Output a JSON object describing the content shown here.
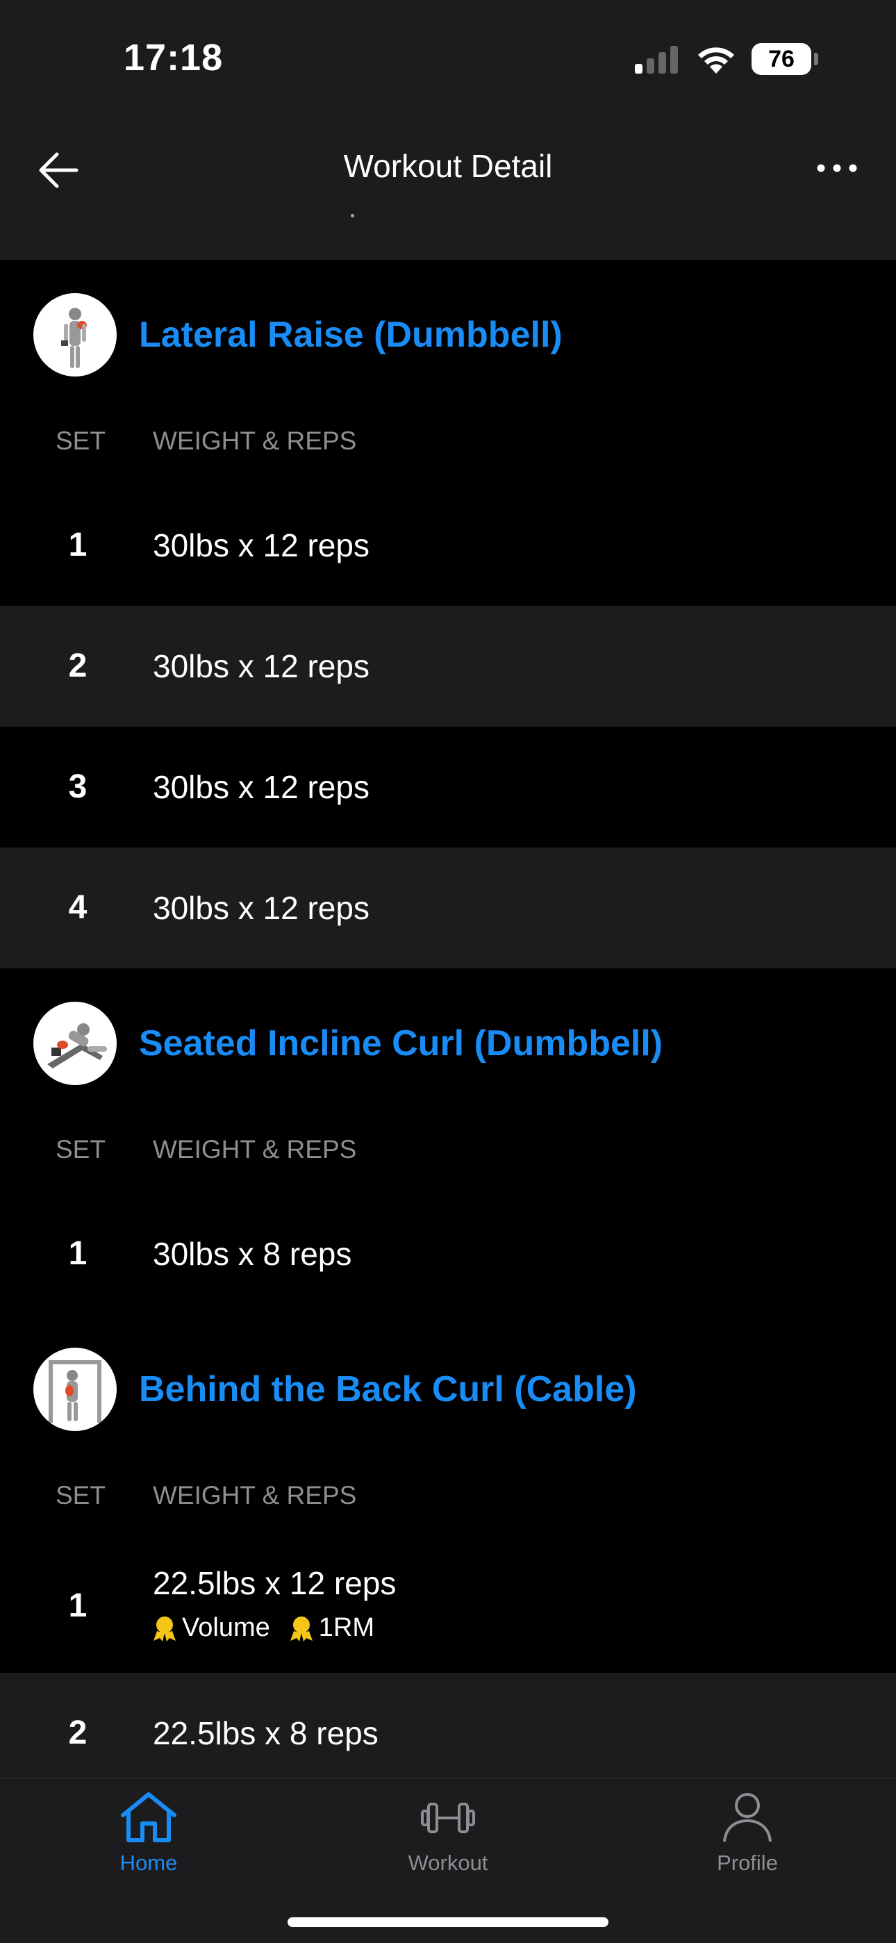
{
  "status_bar": {
    "time": "17:18",
    "battery": "76"
  },
  "header": {
    "title": "Workout Detail"
  },
  "columns": {
    "set": "SET",
    "weight_reps": "WEIGHT & REPS"
  },
  "exercises": [
    {
      "name": "Lateral Raise (Dumbbell)",
      "sets": [
        {
          "num": "1",
          "value": "30lbs x 12 reps"
        },
        {
          "num": "2",
          "value": "30lbs x 12 reps"
        },
        {
          "num": "3",
          "value": "30lbs x 12 reps"
        },
        {
          "num": "4",
          "value": "30lbs x 12 reps"
        }
      ]
    },
    {
      "name": "Seated Incline Curl (Dumbbell)",
      "sets": [
        {
          "num": "1",
          "value": "30lbs x 8 reps"
        }
      ]
    },
    {
      "name": "Behind the Back Curl (Cable)",
      "sets": [
        {
          "num": "1",
          "value": "22.5lbs x 12 reps",
          "badges": [
            "Volume",
            "1RM"
          ]
        },
        {
          "num": "2",
          "value": "22.5lbs x 8 reps"
        }
      ]
    }
  ],
  "tabs": [
    {
      "label": "Home",
      "icon": "home-icon",
      "active": true
    },
    {
      "label": "Workout",
      "icon": "dumbbell-icon",
      "active": false
    },
    {
      "label": "Profile",
      "icon": "person-icon",
      "active": false
    }
  ],
  "colors": {
    "accent": "#1a8cf5",
    "badge": "#f5c518",
    "surface": "#1c1c1e"
  }
}
